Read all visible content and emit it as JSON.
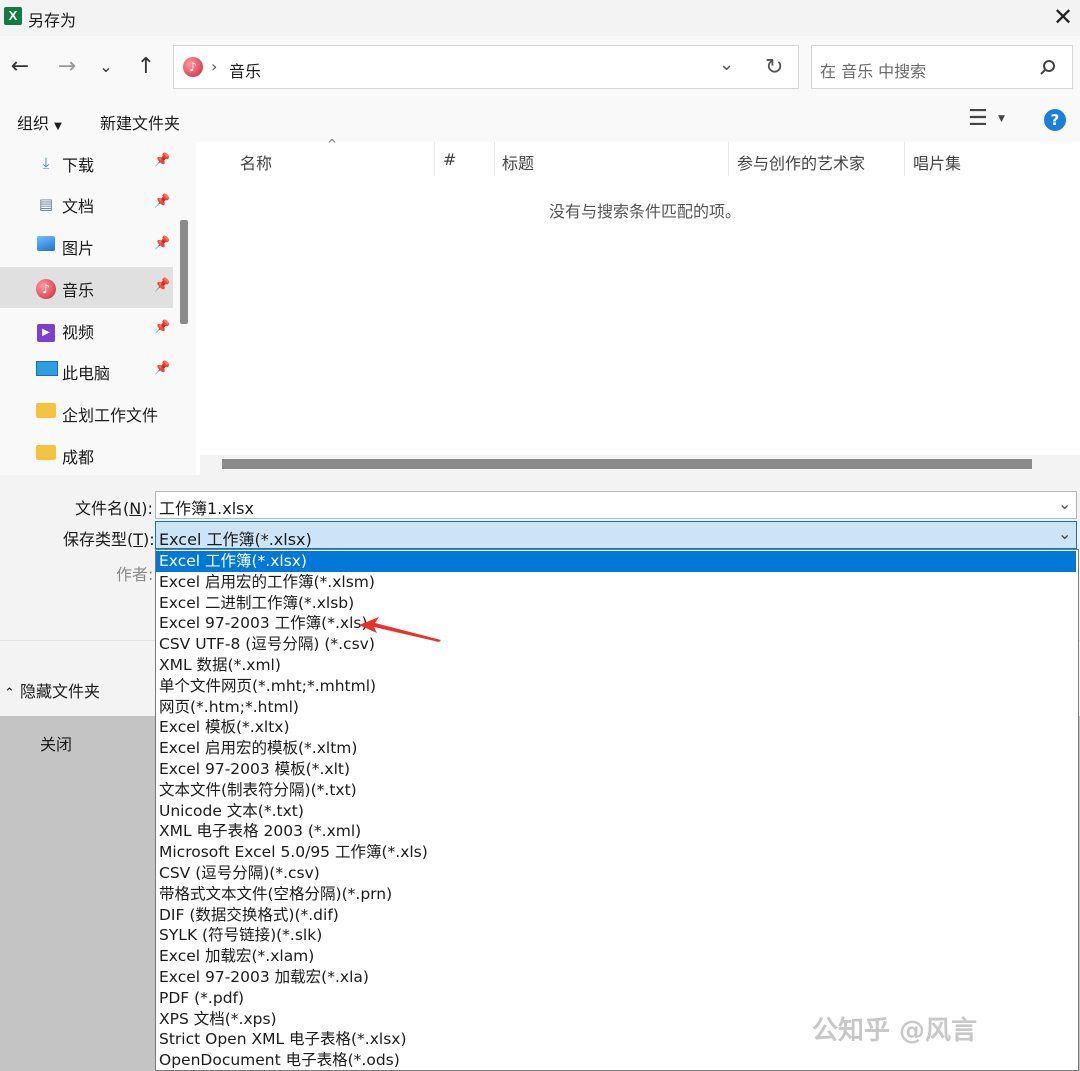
{
  "window": {
    "title": "另存为",
    "app_icon": "excel-icon"
  },
  "nav": {
    "breadcrumb_sep": "›",
    "current_folder": "音乐",
    "search_placeholder": "在 音乐 中搜索"
  },
  "toolbar": {
    "organize": "组织",
    "new_folder": "新建文件夹"
  },
  "sidebar": {
    "items": [
      {
        "label": "下载",
        "icon": "download-icon",
        "pinned": true
      },
      {
        "label": "文档",
        "icon": "document-icon",
        "pinned": true
      },
      {
        "label": "图片",
        "icon": "picture-icon",
        "pinned": true
      },
      {
        "label": "音乐",
        "icon": "music-icon",
        "pinned": true,
        "selected": true
      },
      {
        "label": "视频",
        "icon": "video-icon",
        "pinned": true
      },
      {
        "label": "此电脑",
        "icon": "computer-icon",
        "pinned": true
      },
      {
        "label": "企划工作文件",
        "icon": "folder-icon",
        "pinned": false
      },
      {
        "label": "成都",
        "icon": "folder-icon",
        "pinned": false
      }
    ]
  },
  "columns": {
    "name": "名称",
    "number": "#",
    "title": "标题",
    "artist": "参与创作的艺术家",
    "album": "唱片集"
  },
  "empty_message": "没有与搜索条件匹配的项。",
  "form": {
    "filename_label": "文件名(",
    "filename_key": "N",
    "filename_label_end": "):",
    "filename_value": "工作簿1.xlsx",
    "type_label": "保存类型(",
    "type_key": "T",
    "type_label_end": "):",
    "type_value": "Excel 工作簿(*.xlsx)",
    "author_label": "作者:"
  },
  "footer": {
    "hide_folders": "隐藏文件夹",
    "close": "关闭"
  },
  "file_types": [
    "Excel 工作簿(*.xlsx)",
    "Excel 启用宏的工作簿(*.xlsm)",
    "Excel 二进制工作簿(*.xlsb)",
    "Excel 97-2003 工作簿(*.xls)",
    "CSV UTF-8 (逗号分隔) (*.csv)",
    "XML 数据(*.xml)",
    "单个文件网页(*.mht;*.mhtml)",
    "网页(*.htm;*.html)",
    "Excel 模板(*.xltx)",
    "Excel 启用宏的模板(*.xltm)",
    "Excel 97-2003 模板(*.xlt)",
    "文本文件(制表符分隔)(*.txt)",
    "Unicode 文本(*.txt)",
    "XML 电子表格 2003 (*.xml)",
    "Microsoft Excel 5.0/95 工作簿(*.xls)",
    "CSV (逗号分隔)(*.csv)",
    "带格式文本文件(空格分隔)(*.prn)",
    "DIF (数据交换格式)(*.dif)",
    "SYLK (符号链接)(*.slk)",
    "Excel 加载宏(*.xlam)",
    "Excel 97-2003 加载宏(*.xla)",
    "PDF (*.pdf)",
    "XPS 文档(*.xps)",
    "Strict Open XML 电子表格(*.xlsx)",
    "OpenDocument 电子表格(*.ods)"
  ],
  "highlighted_type_index": 0,
  "watermark": "公知乎 @风言",
  "colors": {
    "accent": "#0078d7",
    "help": "#1a7fd6",
    "arrow": "#e8332a",
    "excel": "#107c41"
  }
}
